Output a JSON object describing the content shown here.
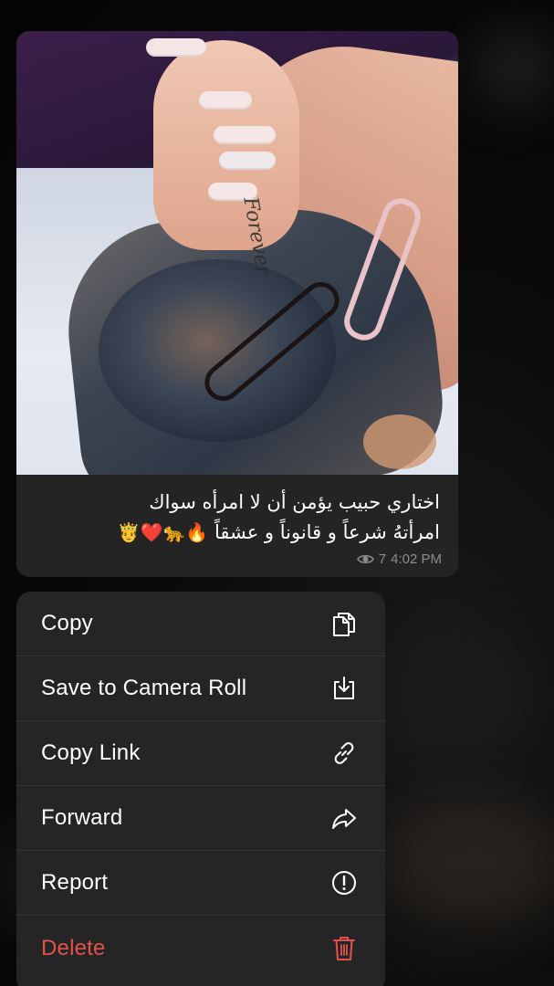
{
  "message": {
    "caption_line1": "اختاري حبيب يؤمن أن لا امرأه سواك",
    "caption_line2": "امرأتهُ شرعاً و قانوناً و عشقاً",
    "caption_emojis": "🔥🐆❤️🤴",
    "tattoo_text": "Forever",
    "views": "7",
    "time": "4:02 PM"
  },
  "menu": {
    "items": [
      {
        "label": "Copy",
        "icon": "copy-icon"
      },
      {
        "label": "Save to Camera Roll",
        "icon": "save-download-icon"
      },
      {
        "label": "Copy Link",
        "icon": "link-icon"
      },
      {
        "label": "Forward",
        "icon": "forward-arrow-icon"
      },
      {
        "label": "Report",
        "icon": "report-exclamation-icon"
      },
      {
        "label": "Delete",
        "icon": "trash-icon",
        "color": "#e4514a"
      }
    ]
  }
}
